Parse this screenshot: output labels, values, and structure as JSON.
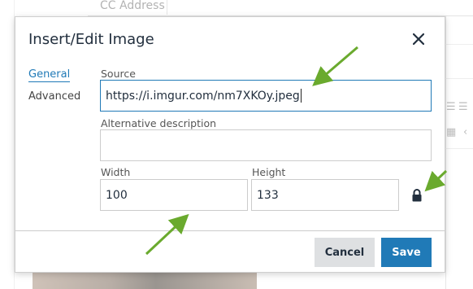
{
  "background": {
    "cc_label": "CC Address"
  },
  "dialog": {
    "title": "Insert/Edit Image",
    "close_icon": "close-icon",
    "tabs": [
      {
        "label": "General",
        "active": true
      },
      {
        "label": "Advanced",
        "active": false
      }
    ],
    "fields": {
      "source": {
        "label": "Source",
        "value": "https://i.imgur.com/nm7XKOy.jpeg"
      },
      "alt": {
        "label": "Alternative description",
        "value": ""
      },
      "width": {
        "label": "Width",
        "value": "100"
      },
      "height": {
        "label": "Height",
        "value": "133"
      }
    },
    "lock_icon": "lock-icon",
    "buttons": {
      "cancel": "Cancel",
      "save": "Save"
    }
  },
  "colors": {
    "accent": "#207ab7",
    "annotation_arrow": "#6aaa2e",
    "title_text": "#222f3e",
    "cancel_bg": "#dee0e2"
  }
}
